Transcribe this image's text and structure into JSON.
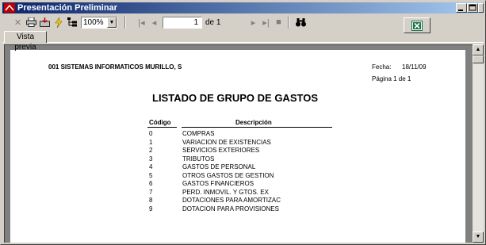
{
  "window": {
    "title": "Presentación Preliminar"
  },
  "toolbar": {
    "zoom_value": "100%",
    "current_page": "1",
    "of_pages": "de 1"
  },
  "tabs": [
    {
      "label": "Vista previa"
    }
  ],
  "report": {
    "company": "001 SISTEMAS INFORMATICOS MURILLO, S",
    "date_label": "Fecha:",
    "date_value": "18/11/09",
    "page_label": "Página 1 de 1",
    "title": "LISTADO DE GRUPO DE GASTOS",
    "col_code": "Código",
    "col_desc": "Descripción",
    "rows": [
      {
        "code": "0",
        "desc": "COMPRAS"
      },
      {
        "code": "1",
        "desc": "VARIACION DE EXISTENCIAS"
      },
      {
        "code": "2",
        "desc": "SERVICIOS EXTERIORES"
      },
      {
        "code": "3",
        "desc": "TRIBUTOS"
      },
      {
        "code": "4",
        "desc": "GASTOS DE PERSONAL"
      },
      {
        "code": "5",
        "desc": "OTROS GASTOS DE GESTION"
      },
      {
        "code": "6",
        "desc": "GASTOS FINANCIEROS"
      },
      {
        "code": "7",
        "desc": "PERD. INMOVIL. Y GTOS. EX"
      },
      {
        "code": "8",
        "desc": "DOTACIONES PARA AMORTIZAC"
      },
      {
        "code": "9",
        "desc": "DOTACION PARA PROVISIONES"
      }
    ]
  },
  "colors": {
    "title_gradient_start": "#0a246a",
    "title_gradient_end": "#a6caf0",
    "face": "#d4d0c8",
    "preview_bg": "#808080",
    "excel_green": "#1e7145"
  }
}
